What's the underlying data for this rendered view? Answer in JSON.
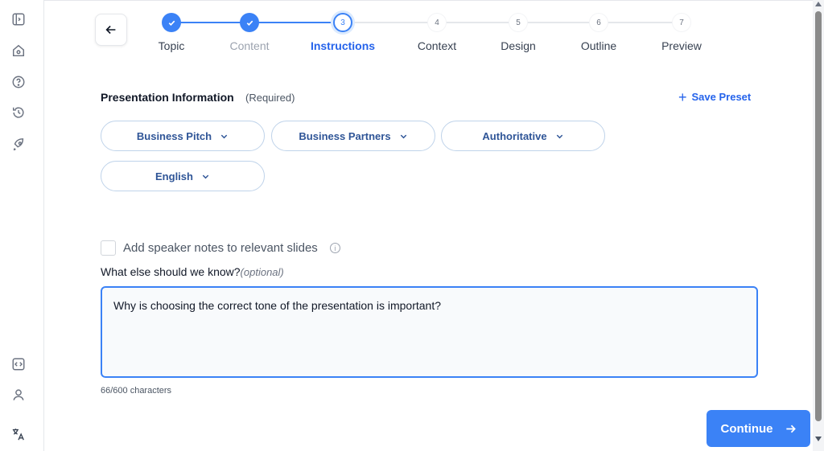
{
  "sidebar": {
    "icons": [
      "panel-toggle-icon",
      "home-icon",
      "help-icon",
      "history-icon",
      "rocket-icon",
      "code-icon",
      "user-icon",
      "translate-icon"
    ]
  },
  "stepper": {
    "steps": [
      {
        "number": "1",
        "label": "Topic",
        "state": "done"
      },
      {
        "number": "2",
        "label": "Content",
        "state": "done"
      },
      {
        "number": "3",
        "label": "Instructions",
        "state": "current"
      },
      {
        "number": "4",
        "label": "Context",
        "state": "todo"
      },
      {
        "number": "5",
        "label": "Design",
        "state": "todo"
      },
      {
        "number": "6",
        "label": "Outline",
        "state": "todo"
      },
      {
        "number": "7",
        "label": "Preview",
        "state": "todo"
      }
    ]
  },
  "section": {
    "title": "Presentation Information",
    "subtitle": "(Required)",
    "save_preset": "Save Preset"
  },
  "selects": {
    "presentation_type": "Business Pitch",
    "audience": "Business Partners",
    "tone": "Authoritative",
    "language": "English"
  },
  "speaker_notes": {
    "label": "Add speaker notes to relevant slides",
    "checked": false
  },
  "instructions": {
    "label": "What else should we know?",
    "optional": "(optional)",
    "value": "Why is choosing the correct tone of the presentation is important?",
    "char_count": "66/600 characters"
  },
  "actions": {
    "continue_label": "Continue"
  },
  "colors": {
    "accent": "#3b82f6",
    "pill_text": "#2f5597",
    "pill_border": "#bfd3ea"
  }
}
